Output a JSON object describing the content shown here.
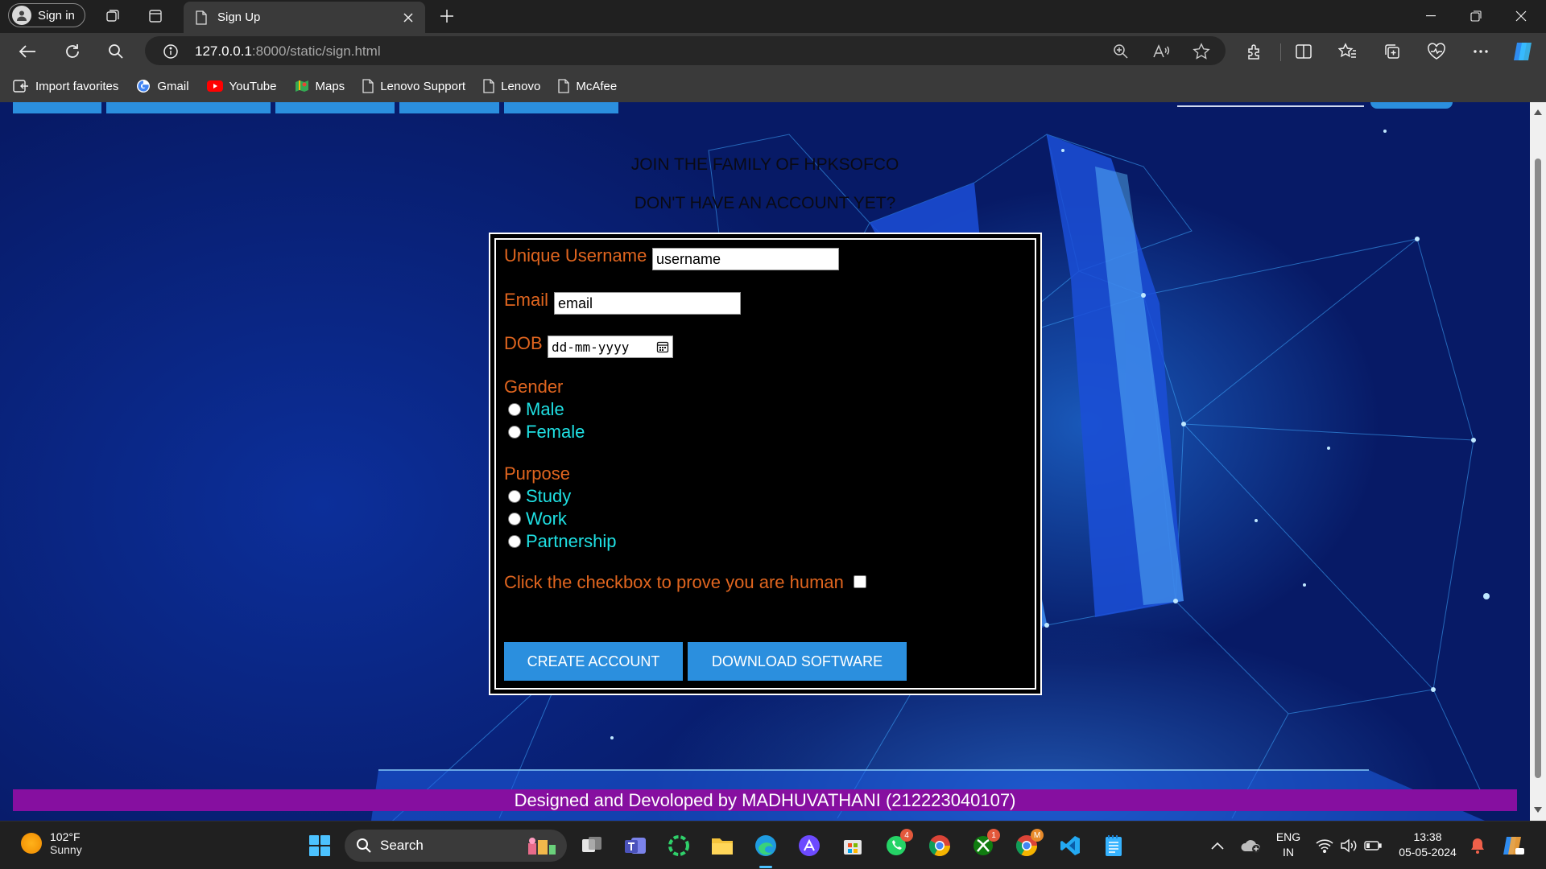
{
  "browser": {
    "profile_label": "Sign in",
    "tab_title": "Sign Up",
    "url_host": "127.0.0.1",
    "url_rest": ":8000/static/sign.html",
    "favorites": [
      "Import favorites",
      "Gmail",
      "YouTube",
      "Maps",
      "Lenovo Support",
      "Lenovo",
      "McAfee"
    ]
  },
  "page": {
    "heading1": "JOIN THE FAMILY OF HPKSOFCO",
    "heading2": "DON'T HAVE AN ACCOUNT YET?",
    "form": {
      "username_label": "Unique Username",
      "username_value": "username",
      "email_label": "Email",
      "email_value": "email",
      "dob_label": "DOB",
      "dob_placeholder": "dd-mm-yyyy",
      "gender_label": "Gender",
      "gender_options": [
        "Male",
        "Female"
      ],
      "purpose_label": "Purpose",
      "purpose_options": [
        "Study",
        "Work",
        "Partnership"
      ],
      "human_check_label": "Click the checkbox to prove you are human",
      "create_button": "CREATE ACCOUNT",
      "download_button": "DOWNLOAD SOFTWARE"
    },
    "footer": "Designed and Devoloped by MADHUVATHANI (212223040107)"
  },
  "taskbar": {
    "weather_temp": "102°F",
    "weather_desc": "Sunny",
    "search_label": "Search",
    "whatsapp_badge": "4",
    "xbox_badge": "1",
    "chrome_profile_badge": "M",
    "lang_line1": "ENG",
    "lang_line2": "IN",
    "time": "13:38",
    "date": "05-05-2024"
  },
  "colors": {
    "accent_button": "#2b8fde",
    "label_orange": "#e0651f",
    "option_cyan": "#1fe0e3",
    "footer_purple": "#860fa0"
  }
}
